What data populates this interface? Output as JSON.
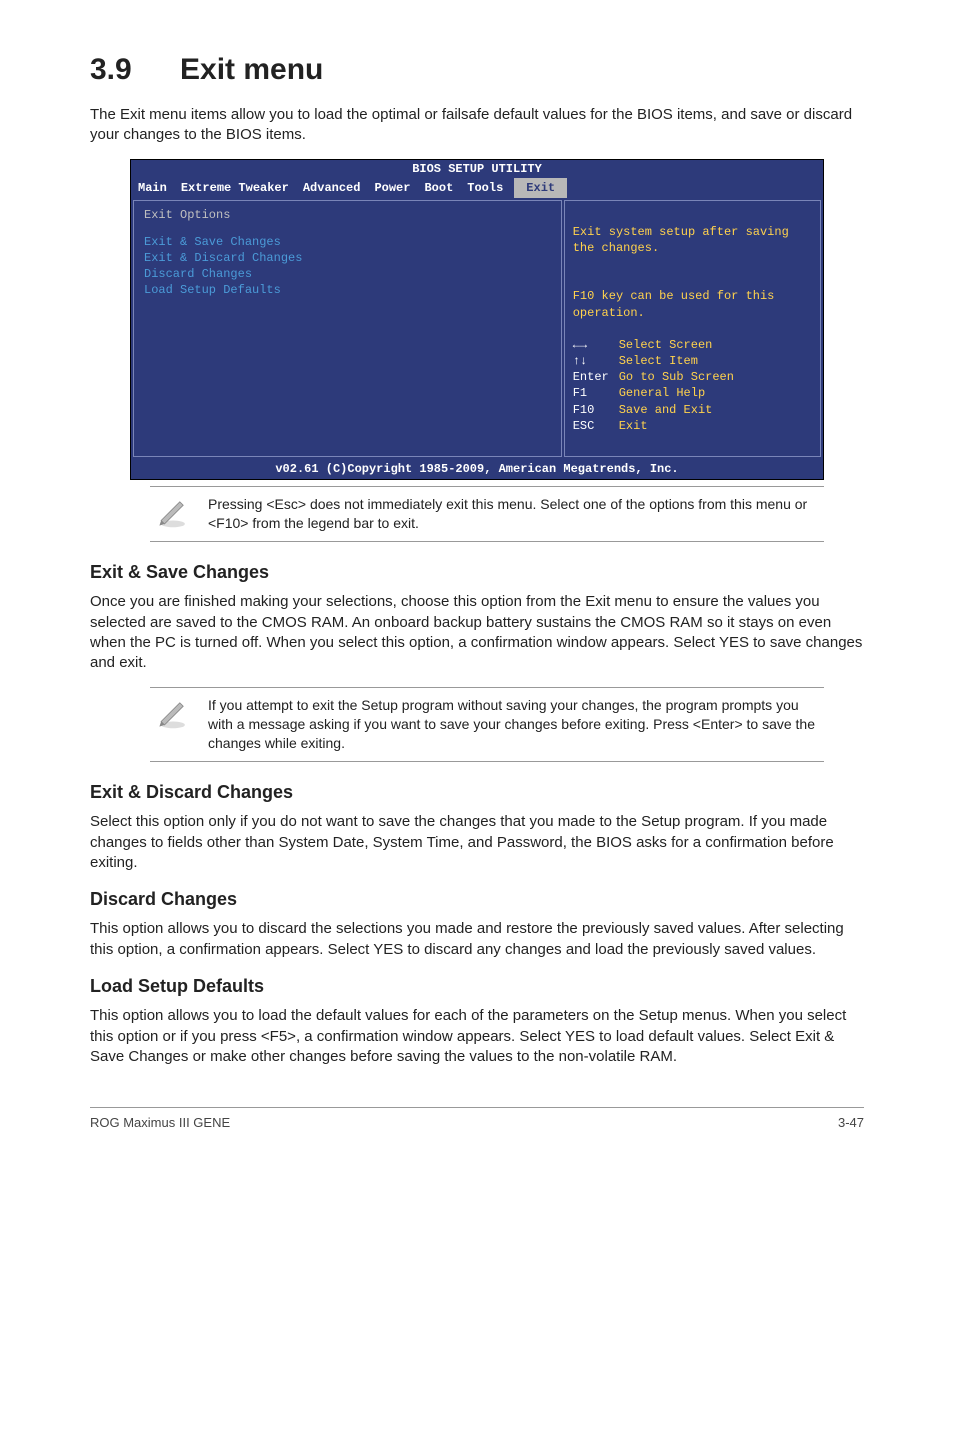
{
  "page": {
    "section_number": "3.9",
    "section_title": "Exit menu",
    "intro": "The Exit menu items allow you to load the optimal or failsafe default values for the BIOS items, and save or discard your changes to the BIOS items."
  },
  "bios": {
    "title": "BIOS SETUP UTILITY",
    "tabs": [
      "Main",
      "Extreme Tweaker",
      "Advanced",
      "Power",
      "Boot",
      "Tools",
      "Exit"
    ],
    "active_tab": "Exit",
    "left": {
      "options_label": "Exit Options",
      "items": [
        "Exit & Save Changes",
        "Exit & Discard Changes",
        "Discard Changes",
        "",
        "Load Setup Defaults"
      ]
    },
    "right": {
      "help_line1": "Exit system setup after saving the changes.",
      "help_line2": "F10 key can be used for this operation.",
      "nav": [
        {
          "key": "←→",
          "label": "Select Screen"
        },
        {
          "key": "↑↓",
          "label": "Select Item"
        },
        {
          "key": "Enter",
          "label": "Go to Sub Screen"
        },
        {
          "key": "F1",
          "label": "General Help"
        },
        {
          "key": "F10",
          "label": "Save and Exit"
        },
        {
          "key": "ESC",
          "label": "Exit"
        }
      ]
    },
    "footer": "v02.61 (C)Copyright 1985-2009, American Megatrends, Inc."
  },
  "note1": "Pressing <Esc> does not immediately exit this menu. Select one of the options from this menu or <F10> from the legend bar to exit.",
  "sections": {
    "exit_save": {
      "heading": "Exit & Save Changes",
      "body": "Once you are finished making your selections, choose this option from the Exit menu to ensure the values you selected are saved to the CMOS RAM. An onboard backup battery sustains the CMOS RAM so it stays on even when the PC is turned off. When you select this option, a confirmation window appears. Select YES to save changes and exit."
    },
    "exit_discard": {
      "heading": "Exit & Discard Changes",
      "body": "Select this option only if you do not want to save the changes that you  made to the Setup program. If you made changes to fields other than System Date, System Time, and Password, the BIOS asks for a confirmation before exiting."
    },
    "discard": {
      "heading": "Discard Changes",
      "body": "This option allows you to discard the selections you made and restore the previously saved values. After selecting this option, a confirmation appears. Select YES to discard any changes and load the previously saved values."
    },
    "load_defaults": {
      "heading": "Load Setup Defaults",
      "body": "This option allows you to load the default values for each of the parameters on the Setup menus. When you select this option or if you press <F5>, a confirmation window appears. Select YES to load default values. Select Exit & Save Changes or make other changes before saving the values to the non-volatile RAM."
    }
  },
  "note2": " If you attempt to exit the Setup program without saving your changes, the program prompts you with a message asking if you want to save your changes before exiting. Press <Enter>  to save the changes while exiting.",
  "footer": {
    "left": "ROG Maximus III GENE",
    "right": "3-47"
  }
}
